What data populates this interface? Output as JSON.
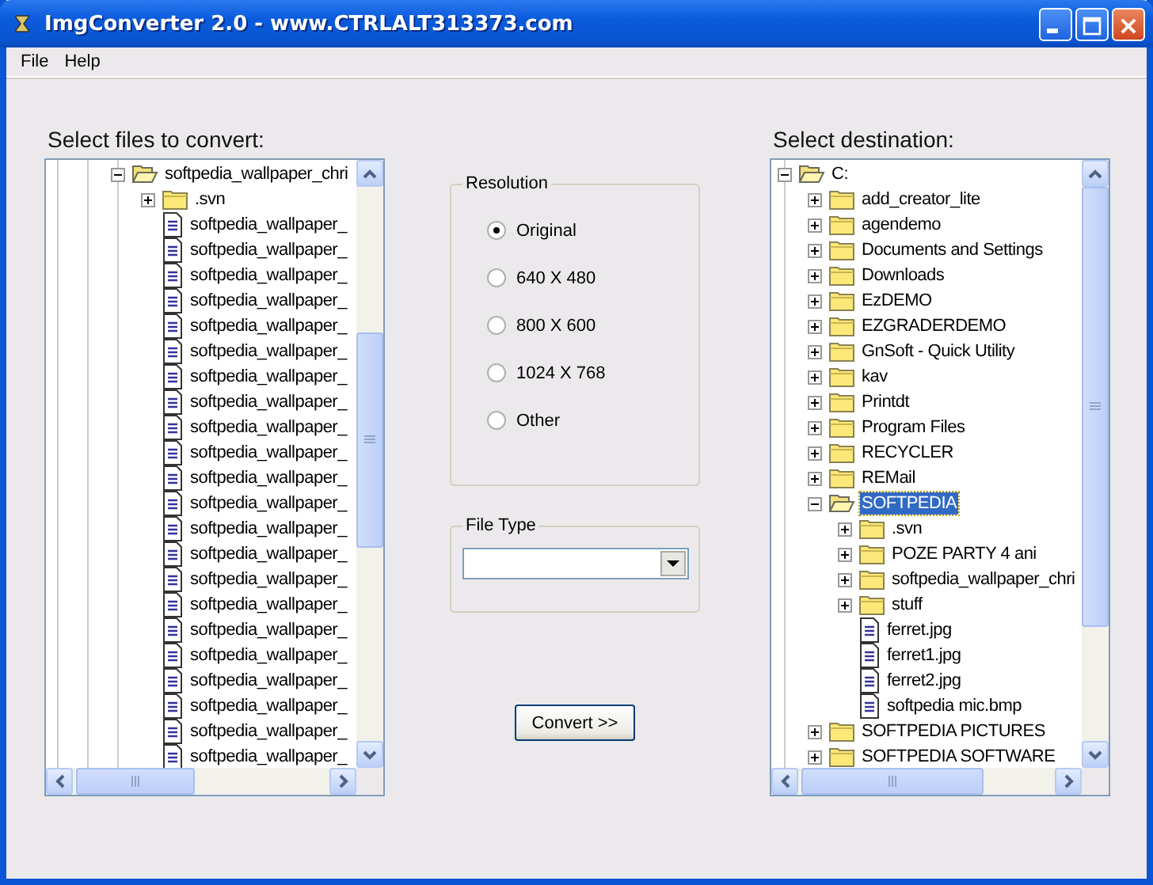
{
  "window": {
    "title": "ImgConverter 2.0 - www.CTRLALT313373.com"
  },
  "menu": [
    {
      "label": "File"
    },
    {
      "label": "Help"
    }
  ],
  "source": {
    "heading": "Select files to convert:",
    "items": [
      {
        "label": "softpedia_wallpaper_chri",
        "kind": "folder",
        "expanded": true,
        "selected": false,
        "children": [
          {
            "label": ".svn",
            "kind": "folder",
            "expanded": false,
            "selected": false
          },
          {
            "label": "softpedia_wallpaper_",
            "kind": "file",
            "selected": false
          },
          {
            "label": "softpedia_wallpaper_",
            "kind": "file",
            "selected": false
          },
          {
            "label": "softpedia_wallpaper_",
            "kind": "file",
            "selected": false
          },
          {
            "label": "softpedia_wallpaper_",
            "kind": "file",
            "selected": false
          },
          {
            "label": "softpedia_wallpaper_",
            "kind": "file",
            "selected": false
          },
          {
            "label": "softpedia_wallpaper_",
            "kind": "file",
            "selected": false
          },
          {
            "label": "softpedia_wallpaper_",
            "kind": "file",
            "selected": false
          },
          {
            "label": "softpedia_wallpaper_",
            "kind": "file",
            "selected": false
          },
          {
            "label": "softpedia_wallpaper_",
            "kind": "file",
            "selected": false
          },
          {
            "label": "softpedia_wallpaper_",
            "kind": "file",
            "selected": false
          },
          {
            "label": "softpedia_wallpaper_",
            "kind": "file",
            "selected": false
          },
          {
            "label": "softpedia_wallpaper_",
            "kind": "file",
            "selected": false
          },
          {
            "label": "softpedia_wallpaper_",
            "kind": "file",
            "selected": false
          },
          {
            "label": "softpedia_wallpaper_",
            "kind": "file",
            "selected": false
          },
          {
            "label": "softpedia_wallpaper_",
            "kind": "file",
            "selected": false
          },
          {
            "label": "softpedia_wallpaper_",
            "kind": "file",
            "selected": false
          },
          {
            "label": "softpedia_wallpaper_",
            "kind": "file",
            "selected": false
          },
          {
            "label": "softpedia_wallpaper_",
            "kind": "file",
            "selected": false
          },
          {
            "label": "softpedia_wallpaper_",
            "kind": "file",
            "selected": false
          },
          {
            "label": "softpedia_wallpaper_",
            "kind": "file",
            "selected": false
          },
          {
            "label": "softpedia_wallpaper_",
            "kind": "file",
            "selected": false
          },
          {
            "label": "softpedia_wallpaper_",
            "kind": "file",
            "selected": false
          }
        ]
      }
    ]
  },
  "resolution": {
    "title": "Resolution",
    "options": [
      {
        "label": "Original",
        "selected": true
      },
      {
        "label": "640 X 480",
        "selected": false
      },
      {
        "label": "800 X 600",
        "selected": false
      },
      {
        "label": "1024 X 768",
        "selected": false
      },
      {
        "label": "Other",
        "selected": false
      }
    ]
  },
  "file_type": {
    "title": "File Type"
  },
  "convert_button": {
    "label": "Convert >>"
  },
  "destination": {
    "heading": "Select destination:",
    "items": [
      {
        "label": "C:",
        "kind": "folder",
        "expanded": true,
        "selected": false,
        "children": [
          {
            "label": "add_creator_lite",
            "kind": "folder",
            "expanded": false,
            "selected": false
          },
          {
            "label": "agendemo",
            "kind": "folder",
            "expanded": false,
            "selected": false
          },
          {
            "label": "Documents and Settings",
            "kind": "folder",
            "expanded": false,
            "selected": false
          },
          {
            "label": "Downloads",
            "kind": "folder",
            "expanded": false,
            "selected": false
          },
          {
            "label": "EzDEMO",
            "kind": "folder",
            "expanded": false,
            "selected": false
          },
          {
            "label": "EZGRADERDEMO",
            "kind": "folder",
            "expanded": false,
            "selected": false
          },
          {
            "label": "GnSoft - Quick Utility",
            "kind": "folder",
            "expanded": false,
            "selected": false
          },
          {
            "label": "kav",
            "kind": "folder",
            "expanded": false,
            "selected": false
          },
          {
            "label": "Printdt",
            "kind": "folder",
            "expanded": false,
            "selected": false
          },
          {
            "label": "Program Files",
            "kind": "folder",
            "expanded": false,
            "selected": false
          },
          {
            "label": "RECYCLER",
            "kind": "folder",
            "expanded": false,
            "selected": false
          },
          {
            "label": "REMail",
            "kind": "folder",
            "expanded": false,
            "selected": false
          },
          {
            "label": "SOFTPEDIA",
            "kind": "folder",
            "expanded": true,
            "selected": true,
            "children": [
              {
                "label": ".svn",
                "kind": "folder",
                "expanded": false,
                "selected": false
              },
              {
                "label": "POZE PARTY 4 ani",
                "kind": "folder",
                "expanded": false,
                "selected": false
              },
              {
                "label": "softpedia_wallpaper_chri",
                "kind": "folder",
                "expanded": false,
                "selected": false
              },
              {
                "label": "stuff",
                "kind": "folder",
                "expanded": false,
                "selected": false
              },
              {
                "label": "ferret.jpg",
                "kind": "file",
                "selected": false
              },
              {
                "label": "ferret1.jpg",
                "kind": "file",
                "selected": false
              },
              {
                "label": "ferret2.jpg",
                "kind": "file",
                "selected": false
              },
              {
                "label": "softpedia mic.bmp",
                "kind": "file",
                "selected": false
              }
            ]
          },
          {
            "label": "SOFTPEDIA PICTURES",
            "kind": "folder",
            "expanded": false,
            "selected": false
          },
          {
            "label": "SOFTPEDIA SOFTWARE",
            "kind": "folder",
            "expanded": false,
            "selected": false
          }
        ]
      }
    ]
  }
}
